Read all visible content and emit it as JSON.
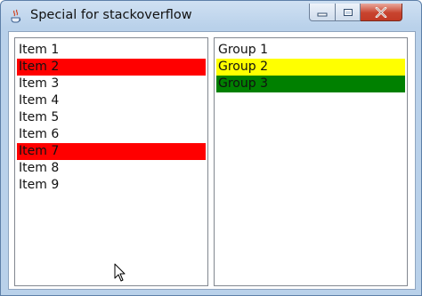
{
  "window": {
    "title": "Special for stackoverflow",
    "controls": {
      "minimize": "minimize-icon",
      "maximize": "maximize-icon",
      "close": "close-icon"
    }
  },
  "colors": {
    "red": "#ff0000",
    "yellow": "#ffff00",
    "green": "#008000"
  },
  "items_list": [
    {
      "label": "Item 1",
      "highlight": ""
    },
    {
      "label": "Item 2",
      "highlight": "red"
    },
    {
      "label": "Item 3",
      "highlight": ""
    },
    {
      "label": "Item 4",
      "highlight": ""
    },
    {
      "label": "Item 5",
      "highlight": ""
    },
    {
      "label": "Item 6",
      "highlight": ""
    },
    {
      "label": "Item 7",
      "highlight": "red"
    },
    {
      "label": "Item 8",
      "highlight": ""
    },
    {
      "label": "Item 9",
      "highlight": ""
    }
  ],
  "groups_list": [
    {
      "label": "Group 1",
      "highlight": ""
    },
    {
      "label": "Group 2",
      "highlight": "yellow"
    },
    {
      "label": "Group 3",
      "highlight": "green"
    }
  ]
}
